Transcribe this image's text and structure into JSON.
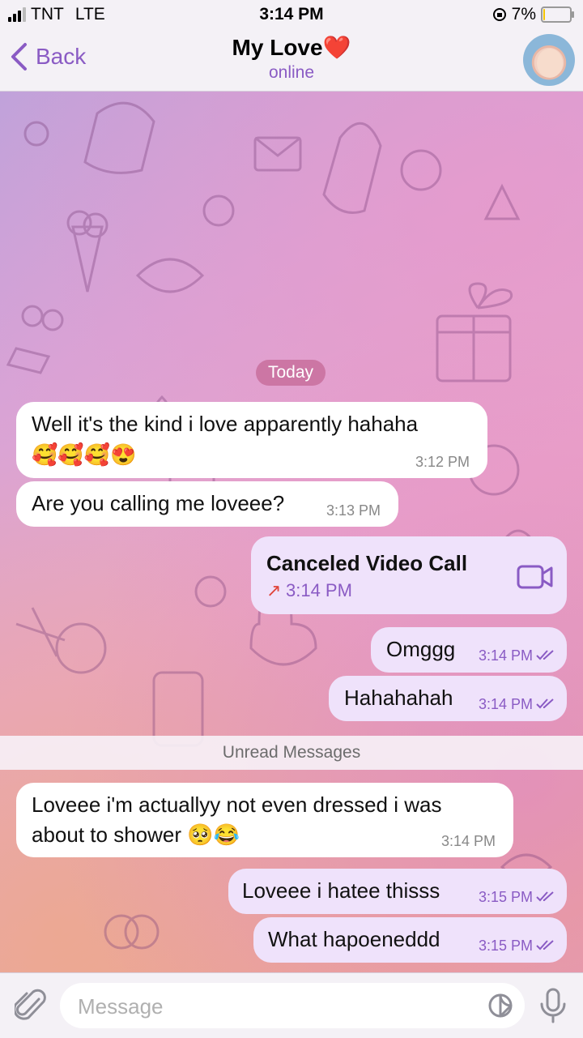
{
  "status_bar": {
    "carrier": "TNT",
    "network": "LTE",
    "time": "3:14 PM",
    "battery": "7%",
    "battery_level": 0.07
  },
  "nav": {
    "back_label": "Back",
    "title": "My Love❤️",
    "status": "online"
  },
  "day_label": "Today",
  "messages": [
    {
      "dir": "in",
      "line1": "Well it's the kind i love apparently hahaha",
      "line2": "🥰🥰🥰😍",
      "time": "3:12 PM"
    },
    {
      "dir": "in",
      "text": "Are you calling me loveee?",
      "time": "3:13 PM"
    },
    {
      "dir": "out",
      "type": "call",
      "title": "Canceled Video Call",
      "arrow": "↗",
      "time": "3:14 PM"
    },
    {
      "dir": "out",
      "text": "Omggg",
      "time": "3:14 PM"
    },
    {
      "dir": "out",
      "text": "Hahahahah",
      "time": "3:14 PM"
    },
    {
      "dir": "in",
      "line1": "Loveee i'm actuallyy not even dressed i was",
      "line2": "about to shower 🥺😂",
      "time": "3:14 PM"
    },
    {
      "dir": "out",
      "text": "Loveee i hatee thisss",
      "time": "3:15 PM"
    },
    {
      "dir": "out",
      "text": "What hapoeneddd",
      "time": "3:15 PM"
    }
  ],
  "unread_label": "Unread Messages",
  "input": {
    "placeholder": "Message"
  },
  "icons": {
    "back": "chevron-left-icon",
    "attach": "paperclip-icon",
    "sticker": "sticker-icon",
    "mic": "microphone-icon",
    "video": "video-camera-icon",
    "read": "double-check-icon"
  },
  "colors": {
    "accent": "#8a5bc4",
    "outgoing_bubble": "#efe2fb",
    "incoming_bubble": "#ffffff",
    "day_pill": "#c46896"
  }
}
